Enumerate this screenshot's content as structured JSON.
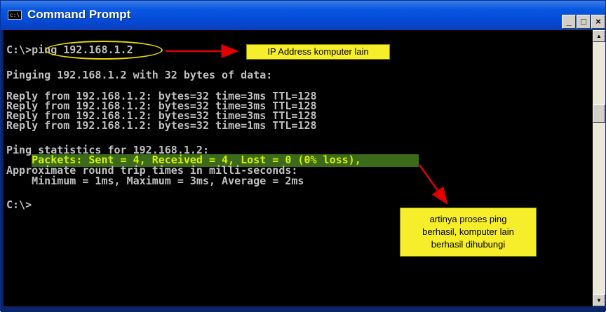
{
  "window": {
    "title": "Command Prompt",
    "icon_text": "c:\\",
    "controls": {
      "minimize": "_",
      "maximize": "□",
      "close": "×"
    }
  },
  "console": {
    "lines": [
      "C:\\>ping 192.168.1.2",
      "Pinging 192.168.1.2 with 32 bytes of data:",
      "Reply from 192.168.1.2: bytes=32 time=3ms TTL=128",
      "Reply from 192.168.1.2: bytes=32 time=3ms TTL=128",
      "Reply from 192.168.1.2: bytes=32 time=3ms TTL=128",
      "Reply from 192.168.1.2: bytes=32 time=1ms TTL=128",
      "Ping statistics for 192.168.1.2:",
      "    Packets: Sent = 4, Received = 4, Lost = 0 (0% loss),",
      "Approximate round trip times in milli-seconds:",
      "    Minimum = 1ms, Maximum = 3ms, Average = 2ms",
      "C:\\>"
    ],
    "text_color": "#c0c0c0",
    "highlight_text_color": "#d8f000"
  },
  "annotations": {
    "ip_note": "IP Address komputer lain",
    "ping_note": [
      "artinya proses ping",
      "berhasil, komputer lain",
      "berhasil dihubungi"
    ],
    "note_color": "#f6ee2a",
    "arrow_color": "#e00000",
    "ellipse_color": "#e6d600",
    "highlight_color": "#3b6b1a"
  }
}
